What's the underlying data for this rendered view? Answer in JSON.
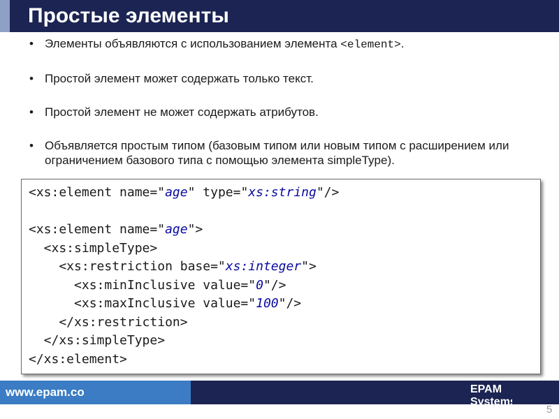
{
  "slide": {
    "title": "Простые элементы",
    "page_number": "5"
  },
  "bullets": [
    {
      "text": "Элементы объявляются с использованием элемента ",
      "code": "<element>",
      "suffix": "."
    },
    {
      "text": "Простой элемент может содержать только текст."
    },
    {
      "text": "Простой элемент не может содержать атрибутов."
    },
    {
      "text": "Объявляется простым типом (базовым типом или новым типом с расширением или ограничением базового типа с помощью элемента simpleType)."
    }
  ],
  "code": {
    "lines": [
      "<xs:element name=\"age\" type=\"xs:string\"/>",
      "",
      "<xs:element name=\"age\">",
      "  <xs:simpleType>",
      "    <xs:restriction base=\"xs:integer\">",
      "      <xs:minInclusive value=\"0\"/>",
      "      <xs:maxInclusive value=\"100\"/>",
      "    </xs:restriction>",
      "  </xs:simpleType>",
      "</xs:element>"
    ]
  },
  "footer": {
    "url": "www.epam.co",
    "company_line1": "EPAM",
    "company_line2": "Systems"
  },
  "colors": {
    "title_bar": "#1b2452",
    "footer_left": "#3b7cc4",
    "code_value": "#0a0aa0"
  }
}
